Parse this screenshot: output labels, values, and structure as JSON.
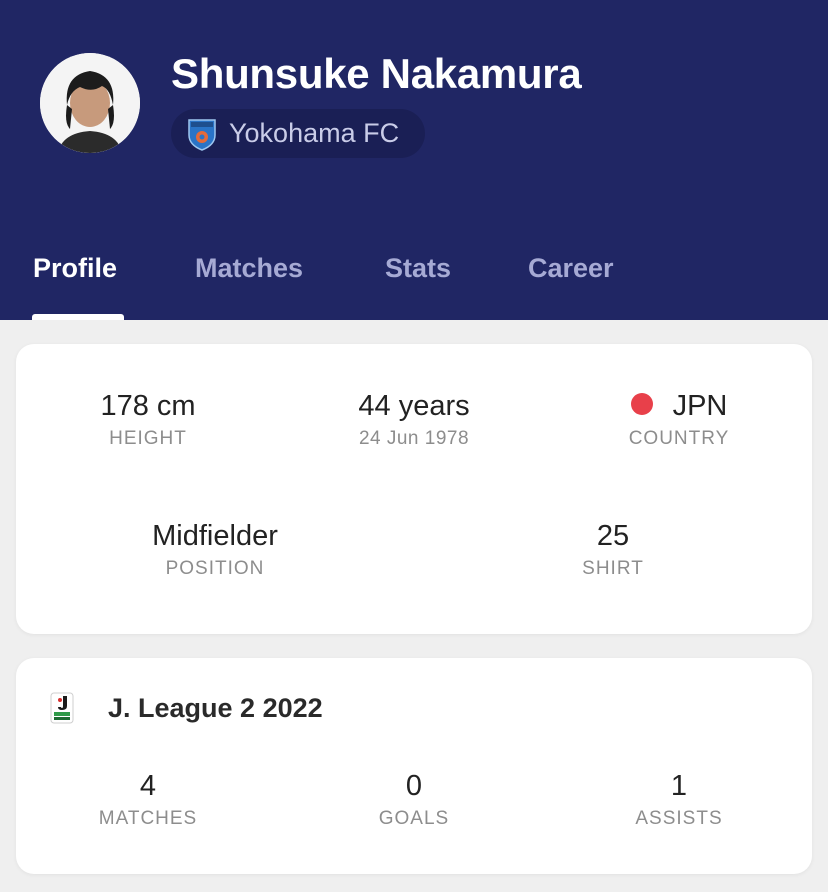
{
  "player": {
    "name": "Shunsuke Nakamura",
    "team": "Yokohama FC"
  },
  "tabs": [
    {
      "label": "Profile",
      "active": true
    },
    {
      "label": "Matches",
      "active": false
    },
    {
      "label": "Stats",
      "active": false
    },
    {
      "label": "Career",
      "active": false
    }
  ],
  "profile": {
    "height": {
      "value": "178 cm",
      "label": "HEIGHT"
    },
    "age": {
      "value": "44 years",
      "sub": "24 Jun 1978"
    },
    "country": {
      "value": "JPN",
      "label": "COUNTRY",
      "flag_color": "#e8404a"
    },
    "position": {
      "value": "Midfielder",
      "label": "POSITION"
    },
    "shirt": {
      "value": "25",
      "label": "SHIRT"
    }
  },
  "league": {
    "name": "J. League 2 2022",
    "matches": {
      "value": "4",
      "label": "MATCHES"
    },
    "goals": {
      "value": "0",
      "label": "GOALS"
    },
    "assists": {
      "value": "1",
      "label": "ASSISTS"
    }
  },
  "colors": {
    "header_bg": "#202664",
    "tab_inactive": "#a6aad4",
    "card_bg": "#ffffff",
    "page_bg": "#efefef"
  },
  "icons": {
    "avatar": "player-photo",
    "team_crest": "yokohama-fc-crest-icon",
    "league_logo": "j-league-logo-icon",
    "country_flag": "japan-flag-icon"
  }
}
